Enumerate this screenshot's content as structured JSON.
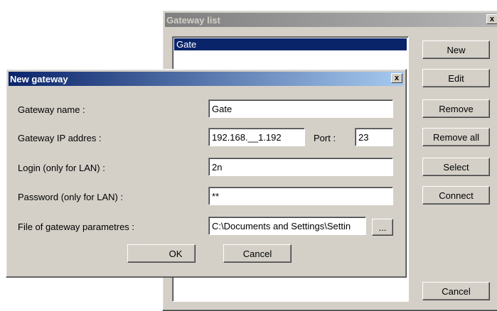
{
  "gateway_list": {
    "title": "Gateway list",
    "close": "x",
    "items": [
      "Gate"
    ],
    "buttons": {
      "new": "New",
      "edit": "Edit",
      "remove": "Remove",
      "remove_all": "Remove all",
      "select": "Select",
      "connect": "Connect",
      "cancel": "Cancel"
    }
  },
  "new_gateway": {
    "title": "New gateway",
    "close": "x",
    "labels": {
      "name": "Gateway name :",
      "ip": "Gateway IP addres :",
      "port": "Port :",
      "login": "Login (only for LAN) :",
      "password": "Password (only for LAN) :",
      "file": "File of gateway parametres :"
    },
    "values": {
      "name": "Gate",
      "ip": "192.168.__1.192",
      "port": "23",
      "login": "2n",
      "password": "**",
      "file": "C:\\Documents and Settings\\Settin"
    },
    "buttons": {
      "browse": "...",
      "ok": "OK",
      "cancel": "Cancel"
    }
  }
}
